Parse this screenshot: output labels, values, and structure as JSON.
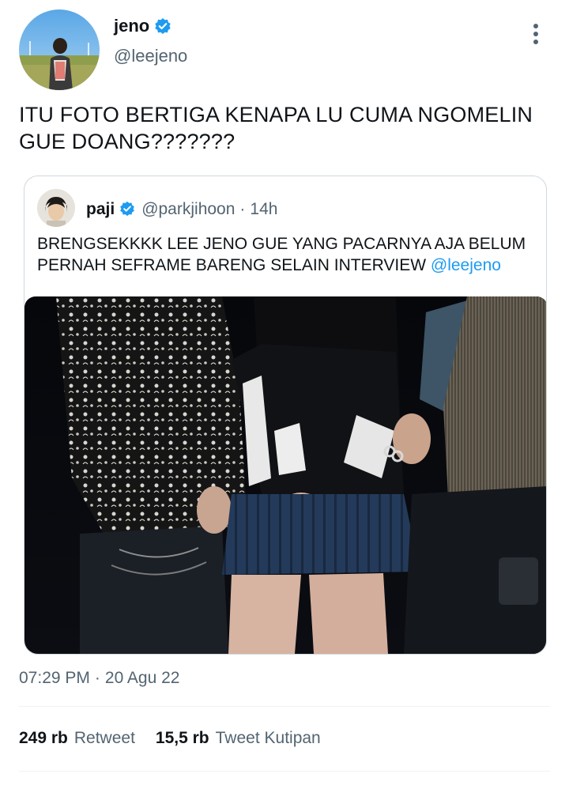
{
  "author": {
    "name": "jeno",
    "handle": "@leejeno"
  },
  "tweet": {
    "text_line1": "ITU FOTO BERTIGA KENAPA LU CUMA NGOMELIN",
    "text_line2": "GUE DOANG???????"
  },
  "quote": {
    "name": "paji",
    "handle": "@parkjihoon",
    "separator": "·",
    "time": "14h",
    "text_line1": "BRENGSEKKKK LEE JENO GUE YANG PACARNYA AJA BELUM",
    "text_line2": "PERNAH SEFRAME BARENG SELAIN INTERVIEW",
    "mention": "@leejeno"
  },
  "meta": {
    "time": "07:29 PM",
    "separator": "·",
    "date": "20 Agu 22"
  },
  "stats": {
    "retweets_count": "249 rb",
    "retweets_label": "Retweet",
    "quotes_count": "15,5 rb",
    "quotes_label": "Tweet Kutipan"
  },
  "icons": {
    "verified": "verified-badge-icon",
    "more": "more-options-icon"
  },
  "colors": {
    "link": "#1d9bf0",
    "secondary_text": "#536471",
    "border": "#cfd9de"
  }
}
